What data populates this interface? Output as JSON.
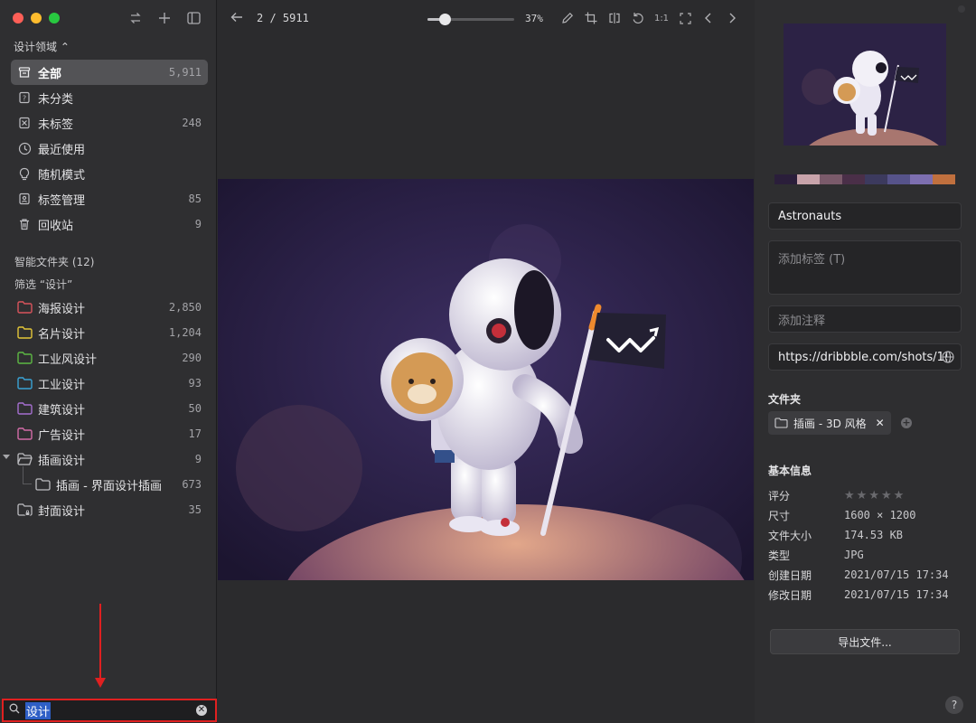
{
  "sidebar": {
    "library_title": "设计领域 ⌃",
    "library_items": [
      {
        "label": "全部",
        "count": "5,911",
        "icon": "all-items-icon"
      },
      {
        "label": "未分类",
        "count": "",
        "icon": "uncategorized-icon"
      },
      {
        "label": "未标签",
        "count": "248",
        "icon": "untagged-icon"
      },
      {
        "label": "最近使用",
        "count": "",
        "icon": "clock-icon"
      },
      {
        "label": "随机模式",
        "count": "",
        "icon": "bulb-icon"
      },
      {
        "label": "标签管理",
        "count": "85",
        "icon": "tag-manager-icon"
      },
      {
        "label": "回收站",
        "count": "9",
        "icon": "trash-icon"
      }
    ],
    "smart_folders_label": "智能文件夹 (12)",
    "filter_label": "筛选 “设计”",
    "folders": [
      {
        "label": "海报设计",
        "count": "2,850",
        "color": "#d9545c"
      },
      {
        "label": "名片设计",
        "count": "1,204",
        "color": "#e3c638"
      },
      {
        "label": "工业风设计",
        "count": "290",
        "color": "#5db844"
      },
      {
        "label": "工业设计",
        "count": "93",
        "color": "#3aa3d6"
      },
      {
        "label": "建筑设计",
        "count": "50",
        "color": "#a56fd0"
      },
      {
        "label": "广告设计",
        "count": "17",
        "color": "#d46ca8"
      },
      {
        "label": "插画设计",
        "count": "9",
        "color": "#bdbdc1"
      },
      {
        "label": "插画 - 界面设计插画",
        "count": "673",
        "color": "#bdbdc1"
      },
      {
        "label": "封面设计",
        "count": "35",
        "color": "#bdbdc1"
      }
    ],
    "search": {
      "value": "设计"
    }
  },
  "toolbar": {
    "pager": "2 / 5911",
    "zoom_label": "37%",
    "zoom_fraction": 0.2,
    "actual_size_label": "1:1"
  },
  "inspector": {
    "title": "Astronauts",
    "tags_placeholder": "添加标签 (T)",
    "note_placeholder": "添加注释",
    "url": "https://dribbble.com/shots/1!",
    "palette": [
      "#2a1e3a",
      "#c8a3aa",
      "#7a5a6a",
      "#4a2f48",
      "#3c3a5e",
      "#56538a",
      "#7d6fb0",
      "#c0703e"
    ],
    "folder_section": "文件夹",
    "folder_chip": "插画 - 3D 风格",
    "basic_info": "基本信息",
    "info": [
      {
        "key": "评分",
        "value": ""
      },
      {
        "key": "尺寸",
        "value": "1600 × 1200"
      },
      {
        "key": "文件大小",
        "value": "174.53 KB"
      },
      {
        "key": "类型",
        "value": "JPG"
      },
      {
        "key": "创建日期",
        "value": "2021/07/15 17:34"
      },
      {
        "key": "修改日期",
        "value": "2021/07/15 17:34"
      }
    ],
    "rating": 0,
    "export_label": "导出文件...",
    "help_label": "?"
  }
}
